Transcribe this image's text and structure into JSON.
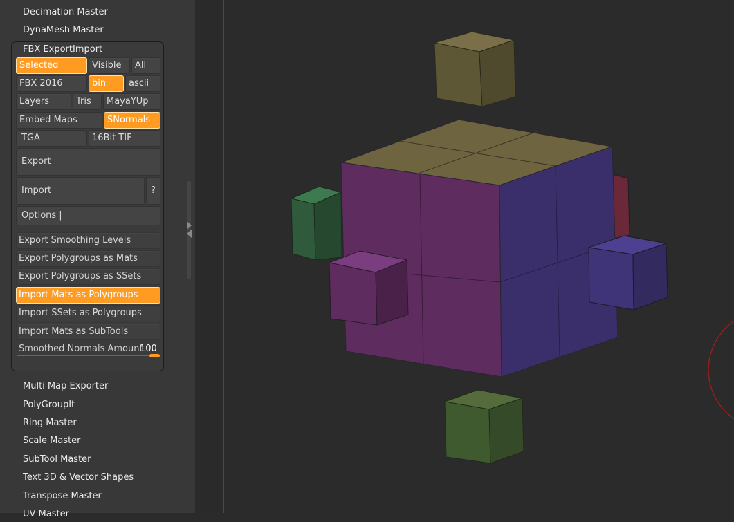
{
  "plugins_above": [
    {
      "label": "Decimation Master"
    },
    {
      "label": "DynaMesh Master"
    }
  ],
  "fbx": {
    "title": "FBX ExportImport",
    "scope": {
      "selected": "Selected",
      "visible": "Visible",
      "all": "All"
    },
    "format": {
      "version": "FBX 2016",
      "bin": "bin",
      "ascii": "ascii"
    },
    "options_row": {
      "layers": "Layers",
      "tris": "Tris",
      "mayayup": "MayaYUp"
    },
    "maps_row": {
      "embed": "Embed Maps",
      "snormals": "SNormals"
    },
    "texture_row": {
      "tga": "TGA",
      "tif": "16Bit TIF"
    },
    "export_label": "Export",
    "import_label": "Import",
    "help_label": "?",
    "options_label": "Options |",
    "toggles": [
      {
        "label": "Export Smoothing Levels",
        "active": false
      },
      {
        "label": "Export Polygroups as Mats",
        "active": false
      },
      {
        "label": "Export Polygroups as SSets",
        "active": false
      },
      {
        "label": "Import Mats as Polygroups",
        "active": true
      },
      {
        "label": "Import SSets as Polygroups",
        "active": false
      },
      {
        "label": "Import Mats as SubTools",
        "active": false
      }
    ],
    "smoothed_normals": {
      "label": "Smoothed Normals Amount",
      "value": "100"
    }
  },
  "plugins_below": [
    {
      "label": "Multi Map Exporter"
    },
    {
      "label": "PolyGroupIt"
    },
    {
      "label": "Ring Master"
    },
    {
      "label": "Scale Master"
    },
    {
      "label": "SubTool Master"
    },
    {
      "label": "Text 3D & Vector Shapes"
    },
    {
      "label": "Transpose Master"
    },
    {
      "label": "UV Master"
    }
  ],
  "colors": {
    "accent": "#ff9b21",
    "panel_bg": "#383838",
    "viewport_bg": "#2b2b2b",
    "cube_top": "#6e6440",
    "cube_front": "#5e2c5e",
    "cube_side": "#3a2f6a",
    "cube_green": "#2f5a3c",
    "cube_olive": "#3f5a2f",
    "cube_red": "#6a2838"
  }
}
